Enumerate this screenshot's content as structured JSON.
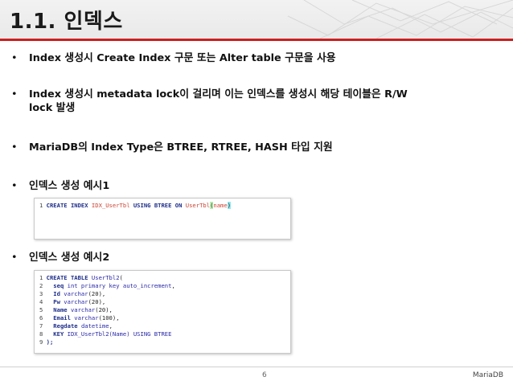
{
  "slide": {
    "title": "1.1. 인덱스",
    "bullets": [
      "Index 생성시 Create Index 구문 또는 Alter table 구문을 사용",
      "Index 생성시 metadata lock이 걸리며 이는 인덱스를 생성시 해당 테이블은 R/W lock 발생",
      "MariaDB의 Index Type은 BTREE, RTREE, HASH 타입 지원",
      "인덱스 생성 예시1",
      "인덱스 생성 예시2"
    ],
    "bullet_marker": "•"
  },
  "example1": {
    "line_no": "1",
    "kw1": "CREATE INDEX",
    "idx": "IDX_UserTbl",
    "kw2": "USING BTREE ON",
    "tbl": "UserTbl",
    "paren_open": "(",
    "col": "name",
    "paren_close": ")"
  },
  "example2": {
    "lines": [
      {
        "n": "1",
        "a": "CREATE TABLE ",
        "b": "UserTbl2",
        "c": "("
      },
      {
        "n": "2",
        "a": "  seq ",
        "b": "int primary key auto_increment",
        "c": ","
      },
      {
        "n": "3",
        "a": "  Id ",
        "b": "varchar",
        "c": "(20),"
      },
      {
        "n": "4",
        "a": "  Pw ",
        "b": "varchar",
        "c": "(20),"
      },
      {
        "n": "5",
        "a": "  Name ",
        "b": "varchar",
        "c": "(20),"
      },
      {
        "n": "6",
        "a": "  Email ",
        "b": "varchar",
        "c": "(100),"
      },
      {
        "n": "7",
        "a": "  Regdate ",
        "b": "datetime",
        "c": ","
      },
      {
        "n": "8",
        "a": "  KEY ",
        "b": "IDX_UserTbl2(Name) USING BTREE",
        "c": ""
      },
      {
        "n": "9",
        "a": ");",
        "b": "",
        "c": ""
      }
    ]
  },
  "footer": {
    "page": "6",
    "brand": "MariaDB"
  },
  "colors": {
    "accent": "#cc1f1f",
    "highlight_green": "#b8f0b0",
    "highlight_cyan": "#8fe8f0"
  }
}
